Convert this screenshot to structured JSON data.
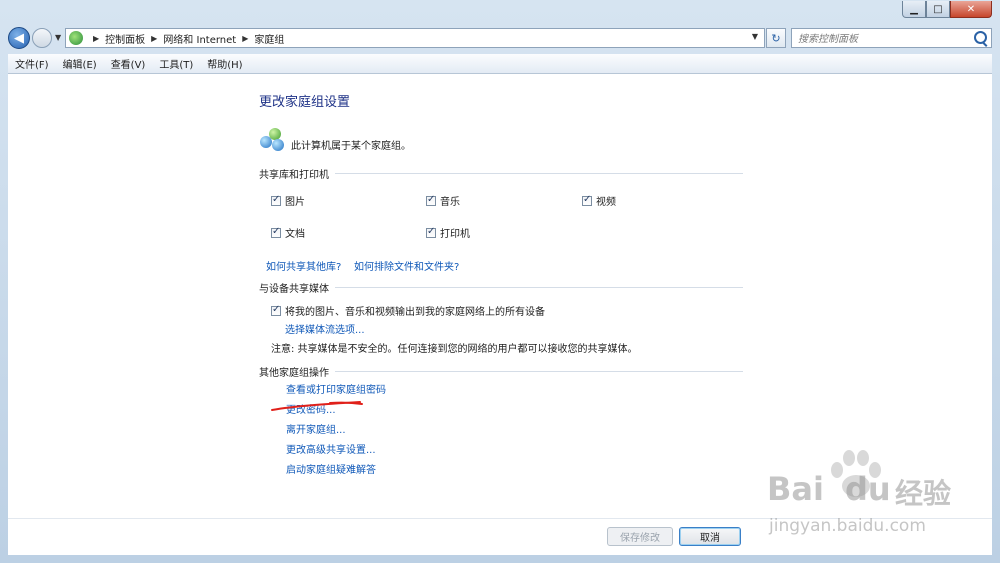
{
  "window": {
    "minimize_glyph": "▁",
    "maximize_glyph": "□",
    "close_glyph": "✕"
  },
  "navigation": {
    "breadcrumb": [
      "控制面板",
      "网络和 Internet",
      "家庭组"
    ],
    "search_placeholder": "搜索控制面板"
  },
  "menu": [
    "文件(F)",
    "编辑(E)",
    "查看(V)",
    "工具(T)",
    "帮助(H)"
  ],
  "page": {
    "title": "更改家庭组设置",
    "status_text": "此计算机属于某个家庭组。",
    "section_libraries": "共享库和打印机",
    "libraries": [
      {
        "label": "图片",
        "checked": true
      },
      {
        "label": "音乐",
        "checked": true
      },
      {
        "label": "视频",
        "checked": true
      },
      {
        "label": "文档",
        "checked": true
      },
      {
        "label": "打印机",
        "checked": true
      }
    ],
    "link_share_other": "如何共享其他库?",
    "link_exclude": "如何排除文件和文件夹?",
    "section_media": "与设备共享媒体",
    "media_stream_label": "将我的图片、音乐和视频输出到我的家庭网络上的所有设备",
    "media_stream_checked": true,
    "link_media_options": "选择媒体流选项...",
    "media_note": "注意: 共享媒体是不安全的。任何连接到您的网络的用户都可以接收您的共享媒体。",
    "section_other": "其他家庭组操作",
    "other_actions": [
      "查看或打印家庭组密码",
      "更改密码...",
      "离开家庭组...",
      "更改高级共享设置...",
      "启动家庭组疑难解答"
    ]
  },
  "buttons": {
    "save": "保存修改",
    "cancel": "取消"
  },
  "watermark": {
    "brand": "Bai",
    "brand2": "du",
    "cn": "经验",
    "url": "jingyan.baidu.com"
  },
  "colors": {
    "link": "#0f58b8",
    "title": "#1e3287",
    "annotation": "#e0201a"
  }
}
